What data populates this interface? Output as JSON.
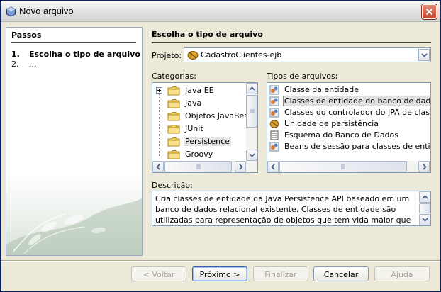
{
  "window": {
    "title": "Novo arquivo",
    "icons": {
      "app": "netbeans-cube-icon",
      "close": "close-x-icon"
    }
  },
  "steps": {
    "title": "Passos",
    "items": [
      {
        "num": "1.",
        "label": "Escolha o tipo de arquivo"
      },
      {
        "num": "2.",
        "label": "..."
      }
    ]
  },
  "main": {
    "title": "Escolha o tipo de arquivo",
    "project_label": "Projeto:",
    "project_value": "CadastroClientes-ejb",
    "categories_label": "Categorias:",
    "categories": [
      {
        "label": "Java EE",
        "expandable": true
      },
      {
        "label": "Java"
      },
      {
        "label": "Objetos JavaBeans"
      },
      {
        "label": "JUnit"
      },
      {
        "label": "Persistence",
        "selected": true
      },
      {
        "label": "Groovy"
      }
    ],
    "file_types_label": "Tipos de arquivos:",
    "file_types": [
      {
        "label": "Classe da entidade",
        "icon": "entity-class-icon"
      },
      {
        "label": "Classes de entidade do banco de dados",
        "icon": "entity-class-icon",
        "selected": true
      },
      {
        "label": "Classes do controlador do JPA de classes d",
        "icon": "entity-class-icon"
      },
      {
        "label": "Unidade de persistência",
        "icon": "persistence-unit-icon"
      },
      {
        "label": "Esquema do Banco de Dados",
        "icon": "database-schema-icon"
      },
      {
        "label": "Beans de sessão para classes de entidade",
        "icon": "entity-class-icon"
      }
    ],
    "description_label": "Descrição:",
    "description": "Cria classes de entidade da Java Persistence API baseado em um banco de dados relacional existente. Classes de entidade são utilizadas para representação de objetos que tem vida maior que uma execução típica de"
  },
  "buttons": {
    "back": "< Voltar",
    "next": "Próximo >",
    "finish": "Finalizar",
    "cancel": "Cancelar",
    "help": "Ajuda"
  },
  "colors": {
    "dialog_bg": "#ece9d8",
    "list_border": "#7f9db9",
    "close_red": "#c5432b"
  }
}
